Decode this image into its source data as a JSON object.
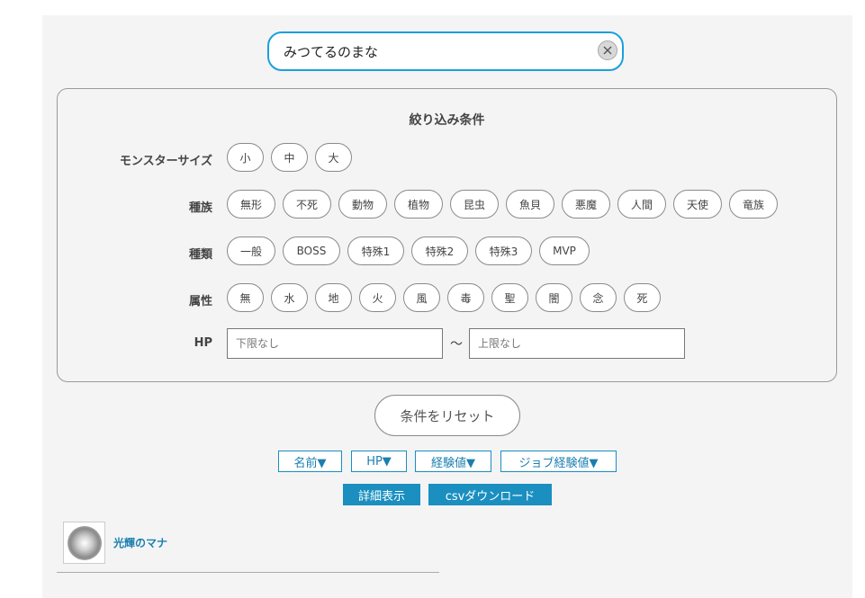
{
  "search": {
    "value": "みつてるのまな",
    "placeholder": ""
  },
  "filters": {
    "title": "絞り込み条件",
    "size": {
      "label": "モンスターサイズ",
      "options": [
        "小",
        "中",
        "大"
      ]
    },
    "race": {
      "label": "種族",
      "options": [
        "無形",
        "不死",
        "動物",
        "植物",
        "昆虫",
        "魚貝",
        "悪魔",
        "人間",
        "天使",
        "竜族"
      ]
    },
    "type": {
      "label": "種類",
      "options": [
        "一般",
        "BOSS",
        "特殊1",
        "特殊2",
        "特殊3",
        "MVP"
      ]
    },
    "element": {
      "label": "属性",
      "options": [
        "無",
        "水",
        "地",
        "火",
        "風",
        "毒",
        "聖",
        "闇",
        "念",
        "死"
      ]
    },
    "hp": {
      "label": "HP",
      "min_placeholder": "下限なし",
      "max_placeholder": "上限なし",
      "separator": "〜"
    }
  },
  "reset_label": "条件をリセット",
  "sort_buttons": [
    "名前▼",
    "HP▼",
    "経験値▼",
    "ジョブ経験値▼"
  ],
  "detail_button": "詳細表示",
  "csv_button": "csvダウンロード",
  "results": [
    {
      "name": "光輝のマナ"
    }
  ],
  "colors": {
    "accent": "#1a8fc0",
    "search_border": "#1aa0dc",
    "panel_bg": "#f4f4f4"
  }
}
